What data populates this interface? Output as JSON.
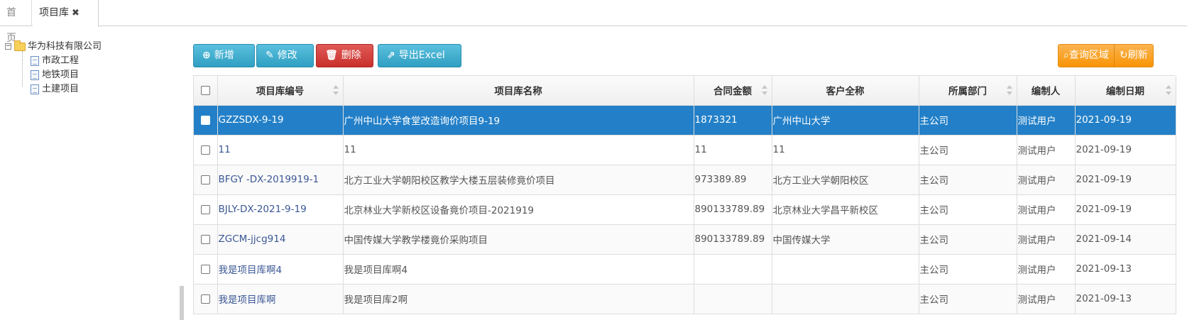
{
  "tabs": {
    "home": "首页",
    "active": "项目库",
    "close_glyph": "✖"
  },
  "tree": {
    "root": "华为科技有限公司",
    "children": [
      "市政工程",
      "地铁项目",
      "土建项目"
    ]
  },
  "toolbar": {
    "add": "新增",
    "edit": "修改",
    "delete": "删除",
    "export": "导出Excel",
    "query": "查询区域",
    "refresh": "刷新"
  },
  "colors": {
    "selected_row": "#2380c8",
    "info": "#31b0d5",
    "danger": "#c9302c",
    "warning": "#f89406"
  },
  "grid": {
    "columns": [
      "项目库编号",
      "项目库名称",
      "合同金额",
      "客户全称",
      "所属部门",
      "编制人",
      "编制日期"
    ],
    "rows": [
      {
        "code": "GZZSDX-9-19",
        "name": "广州中山大学食堂改造询价项目9-19",
        "amount": "1873321",
        "client": "广州中山大学",
        "dept": "主公司",
        "author": "测试用户",
        "date": "2021-09-19"
      },
      {
        "code": "11",
        "name": "11",
        "amount": "11",
        "client": "11",
        "dept": "主公司",
        "author": "测试用户",
        "date": "2021-09-19"
      },
      {
        "code": "BFGY -DX-2019919-1",
        "name": "北方工业大学朝阳校区教学大楼五层装修竟价项目",
        "amount": "973389.89",
        "client": "北方工业大学朝阳校区",
        "dept": "主公司",
        "author": "测试用户",
        "date": "2021-09-19"
      },
      {
        "code": "BJLY-DX-2021-9-19",
        "name": "北京林业大学新校区设备竟价项目-2021919",
        "amount": "890133789.89",
        "client": "北京林业大学昌平新校区",
        "dept": "主公司",
        "author": "测试用户",
        "date": "2021-09-19"
      },
      {
        "code": "ZGCM-jjcg914",
        "name": "中国传媒大学教学楼竟价采购项目",
        "amount": "890133789.89",
        "client": "中国传媒大学",
        "dept": "主公司",
        "author": "测试用户",
        "date": "2021-09-14"
      },
      {
        "code": "我是项目库啊4",
        "name": "我是项目库啊4",
        "amount": "",
        "client": "",
        "dept": "主公司",
        "author": "测试用户",
        "date": "2021-09-13"
      },
      {
        "code": "我是项目库啊",
        "name": "我是项目库2啊",
        "amount": "",
        "client": "",
        "dept": "主公司",
        "author": "测试用户",
        "date": "2021-09-13"
      }
    ]
  }
}
